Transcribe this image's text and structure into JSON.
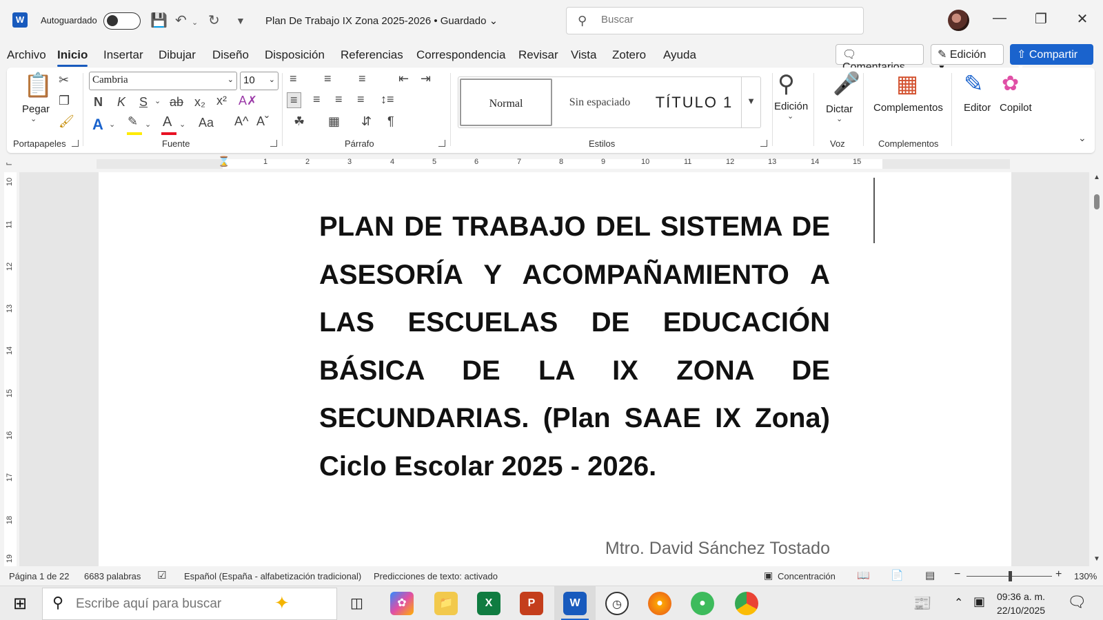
{
  "titlebar": {
    "app_letter": "W",
    "autosave_label": "Autoguardado",
    "doc_title": "Plan De Trabajo IX Zona 2025-2026 • Guardado",
    "search_placeholder": "Buscar"
  },
  "menu": {
    "tabs": [
      "Archivo",
      "Inicio",
      "Insertar",
      "Dibujar",
      "Diseño",
      "Disposición",
      "Referencias",
      "Correspondencia",
      "Revisar",
      "Vista",
      "Zotero",
      "Ayuda"
    ],
    "active": "Inicio",
    "comments": "Comentarios",
    "edit_mode": "Edición",
    "share": "Compartir"
  },
  "ribbon": {
    "paste": "Pegar",
    "clipboard_group": "Portapapeles",
    "font_group": "Fuente",
    "paragraph_group": "Párrafo",
    "styles_group": "Estilos",
    "voice_group": "Voz",
    "addins_group": "Complementos",
    "font_name": "Cambria",
    "font_size": "10",
    "bold": "N",
    "italic": "K",
    "underline": "S",
    "strike": "ab",
    "change_case": "Aa",
    "grow": "A^",
    "shrink": "Aˇ",
    "styles": [
      "Normal",
      "Sin espaciado",
      "Título 1"
    ],
    "editing": "Edición",
    "dictate": "Dictar",
    "addins": "Complementos",
    "editor": "Editor",
    "copilot": "Copilot"
  },
  "ruler": {
    "h_ticks": [
      "1",
      "2",
      "3",
      "4",
      "5",
      "6",
      "7",
      "8",
      "9",
      "10",
      "11",
      "12",
      "13",
      "14",
      "15"
    ],
    "v_ticks": [
      "10",
      "11",
      "12",
      "13",
      "14",
      "15",
      "16",
      "17",
      "18",
      "19"
    ]
  },
  "document": {
    "heading": "PLAN DE TRABAJO DEL SISTEMA DE ASESORÍA Y ACOMPAÑAMIENTO A LAS ESCUELAS DE EDUCACIÓN BÁSICA DE LA IX ZONA DE SECUNDARIAS. (Plan SAAE IX Zona) Ciclo Escolar 2025 - 2026.",
    "author": "Mtro. David Sánchez Tostado"
  },
  "status": {
    "page": "Página 1 de 22",
    "words": "6683 palabras",
    "language": "Español (España - alfabetización tradicional)",
    "predictions": "Predicciones de texto: activado",
    "focus": "Concentración",
    "zoom": "130%"
  },
  "taskbar": {
    "search_placeholder": "Escribe aquí para buscar",
    "time": "09:36 a. m.",
    "date": "22/10/2025"
  },
  "colors": {
    "accent": "#185abd",
    "share": "#1a63cd",
    "font_color_bar": "#e81123",
    "highlight_bar": "#ffeb00"
  }
}
